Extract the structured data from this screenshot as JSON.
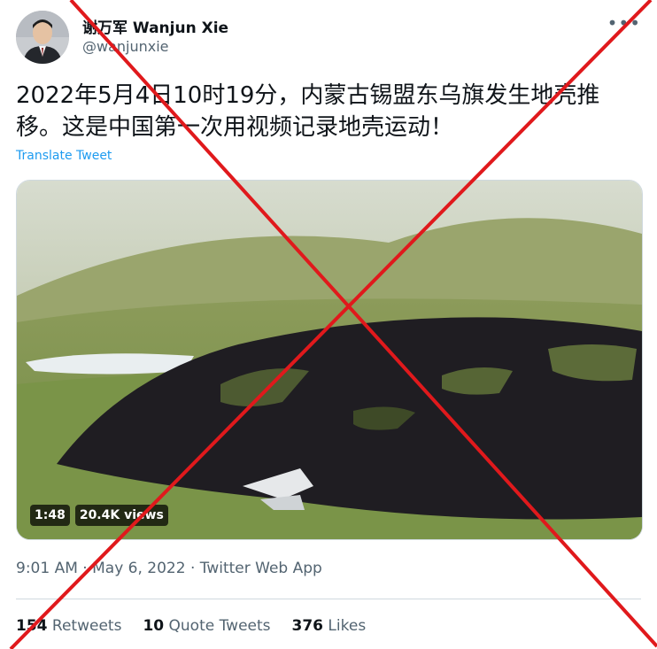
{
  "author": {
    "name": "谢万军 Wanjun Xie",
    "handle": "@wanjunxie"
  },
  "tweet": {
    "text": "2022年5月4日10时19分，内蒙古锡盟东乌旗发生地壳推移。这是中国第一次用视频记录地壳运动！",
    "translate_label": "Translate Tweet"
  },
  "video": {
    "duration": "1:48",
    "views": "20.4K views"
  },
  "meta": {
    "time": "9:01 AM",
    "separator1": " · ",
    "date": "May 6, 2022",
    "separator2": " · ",
    "source": "Twitter Web App"
  },
  "stats": {
    "retweets_count": "154",
    "retweets_label": "Retweets",
    "quotes_count": "10",
    "quotes_label": "Quote Tweets",
    "likes_count": "376",
    "likes_label": "Likes"
  },
  "colors": {
    "cross": "#e0191c",
    "link": "#1d9bf0",
    "secondary_text": "#536471"
  },
  "icons": {
    "more": "more-horizontal-icon"
  }
}
